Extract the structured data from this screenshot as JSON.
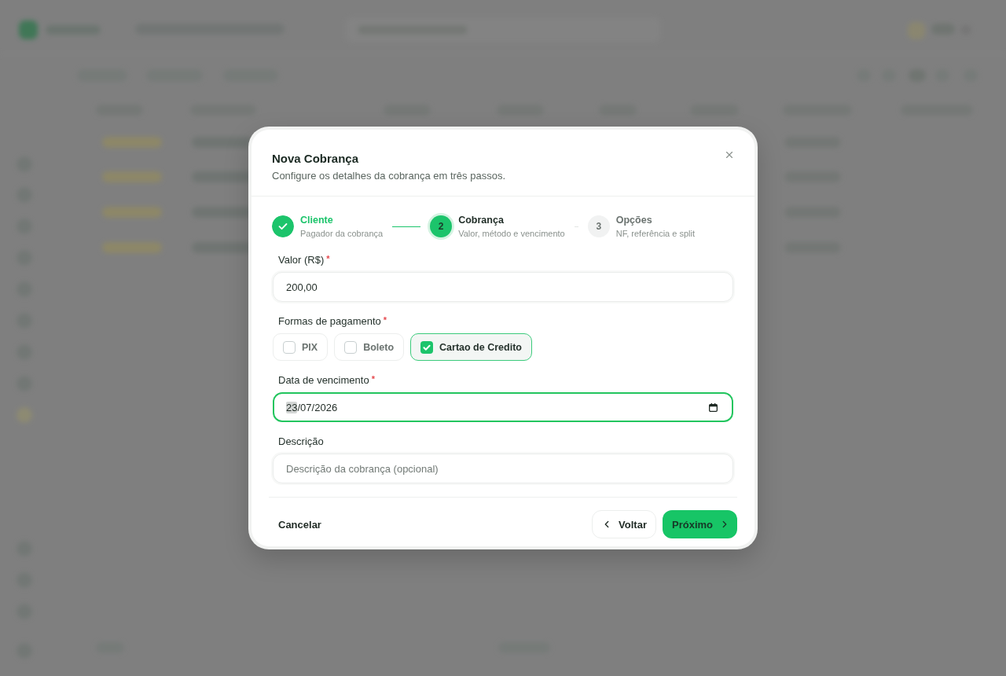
{
  "dialog": {
    "title": "Nova Cobrança",
    "subtitle": "Configure os detalhes da cobrança em três passos."
  },
  "steps": [
    {
      "title": "Cliente",
      "subtitle": "Pagador da cobrança",
      "completed": true,
      "selected": false
    },
    {
      "number": "2",
      "title": "Cobrança",
      "subtitle": "Valor, método e vencimento",
      "completed": false,
      "selected": true
    },
    {
      "number": "3",
      "title": "Opções",
      "subtitle": "NF, referência e split",
      "completed": false,
      "selected": false
    }
  ],
  "form": {
    "amount": {
      "label": "Valor (R$)",
      "required_mark": "*",
      "value": "200,00"
    },
    "payment_methods": {
      "label": "Formas de pagamento",
      "required_mark": "*",
      "options": [
        {
          "label": "PIX",
          "checked": false
        },
        {
          "label": "Boleto",
          "checked": false
        },
        {
          "label": "Cartao de Credito",
          "checked": true
        }
      ]
    },
    "due_date": {
      "label": "Data de vencimento",
      "required_mark": "*",
      "focused": true,
      "separator": "/",
      "segments": [
        {
          "text": "23",
          "selected": true
        },
        {
          "text": "07",
          "selected": false
        },
        {
          "text": "2026",
          "selected": false
        }
      ]
    },
    "description": {
      "label": "Descrição",
      "placeholder": "Descrição da cobrança (opcional)"
    }
  },
  "footer": {
    "cancel": "Cancelar",
    "back": "Voltar",
    "next": "Próximo"
  }
}
